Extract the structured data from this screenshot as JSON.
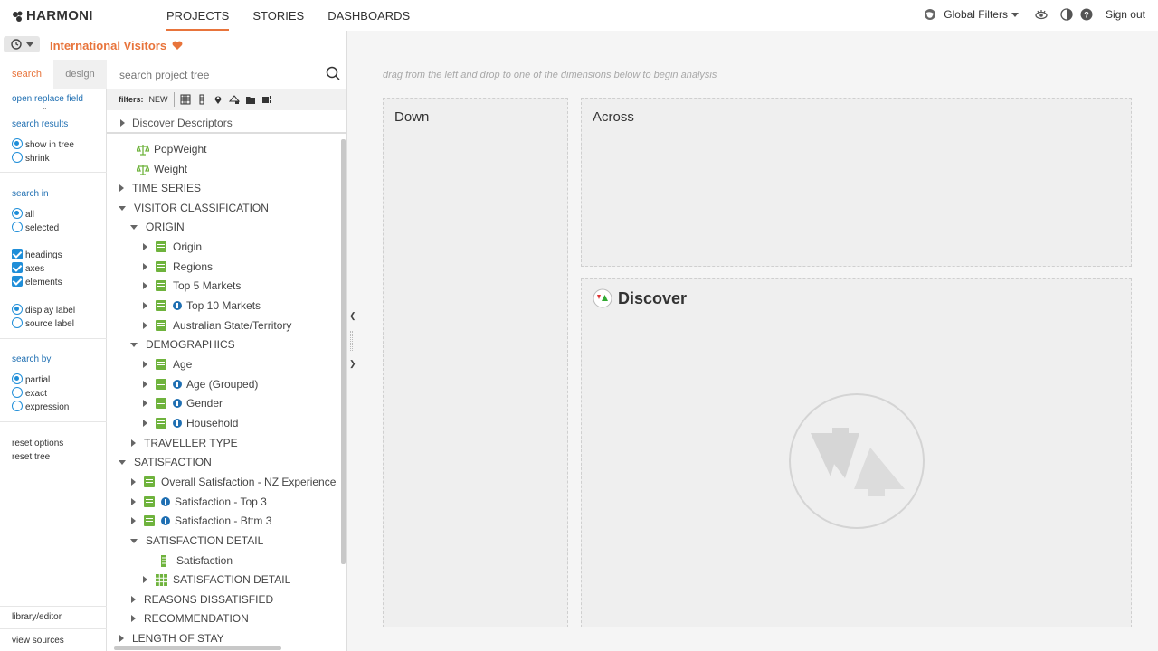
{
  "header": {
    "brand": "HARMONI",
    "nav": [
      {
        "label": "PROJECTS",
        "active": true
      },
      {
        "label": "STORIES",
        "active": false
      },
      {
        "label": "DASHBOARDS",
        "active": false
      }
    ],
    "global_filters": "Global Filters",
    "sign_out": "Sign out",
    "accent_color": "#e8743b"
  },
  "project": {
    "title": "International Visitors"
  },
  "left": {
    "tabs": [
      "search",
      "design"
    ],
    "open_replace_field": "open replace field",
    "search_results": {
      "heading": "search results",
      "options": [
        "show in tree",
        "shrink"
      ],
      "selected": "show in tree"
    },
    "search_in": {
      "heading": "search in",
      "options": [
        "all",
        "selected"
      ],
      "selected": "all"
    },
    "checks": [
      "headings",
      "axes",
      "elements"
    ],
    "label_mode": {
      "options": [
        "display label",
        "source label"
      ],
      "selected": "display label"
    },
    "search_by": {
      "heading": "search by",
      "options": [
        "partial",
        "exact",
        "expression"
      ],
      "selected": "partial"
    },
    "reset_options": "reset options",
    "reset_tree": "reset tree",
    "library_editor": "library/editor",
    "view_sources": "view sources"
  },
  "tree_panel": {
    "search_placeholder": "search project tree",
    "filters_label": "filters:",
    "filters_new": "NEW",
    "discover_descriptors": "Discover Descriptors",
    "rows": [
      {
        "label": "PopWeight"
      },
      {
        "label": "Weight"
      },
      {
        "label": "TIME SERIES"
      },
      {
        "label": "VISITOR CLASSIFICATION"
      },
      {
        "label": "ORIGIN"
      },
      {
        "label": "Origin"
      },
      {
        "label": "Regions"
      },
      {
        "label": "Top 5 Markets"
      },
      {
        "label": "Top 10 Markets"
      },
      {
        "label": "Australian State/Territory"
      },
      {
        "label": "DEMOGRAPHICS"
      },
      {
        "label": "Age"
      },
      {
        "label": "Age (Grouped)"
      },
      {
        "label": "Gender"
      },
      {
        "label": "Household"
      },
      {
        "label": "TRAVELLER TYPE"
      },
      {
        "label": "SATISFACTION"
      },
      {
        "label": "Overall Satisfaction - NZ Experience"
      },
      {
        "label": "Satisfaction - Top 3"
      },
      {
        "label": "Satisfaction - Bttm 3"
      },
      {
        "label": "SATISFACTION DETAIL"
      },
      {
        "label": "Satisfaction"
      },
      {
        "label": "SATISFACTION DETAIL"
      },
      {
        "label": "REASONS DISSATISFIED"
      },
      {
        "label": "RECOMMENDATION"
      },
      {
        "label": "LENGTH OF STAY"
      }
    ]
  },
  "main": {
    "hint": "drag from the left and drop to one of the dimensions below to begin analysis",
    "down_label": "Down",
    "across_label": "Across",
    "discover_label": "Discover"
  }
}
